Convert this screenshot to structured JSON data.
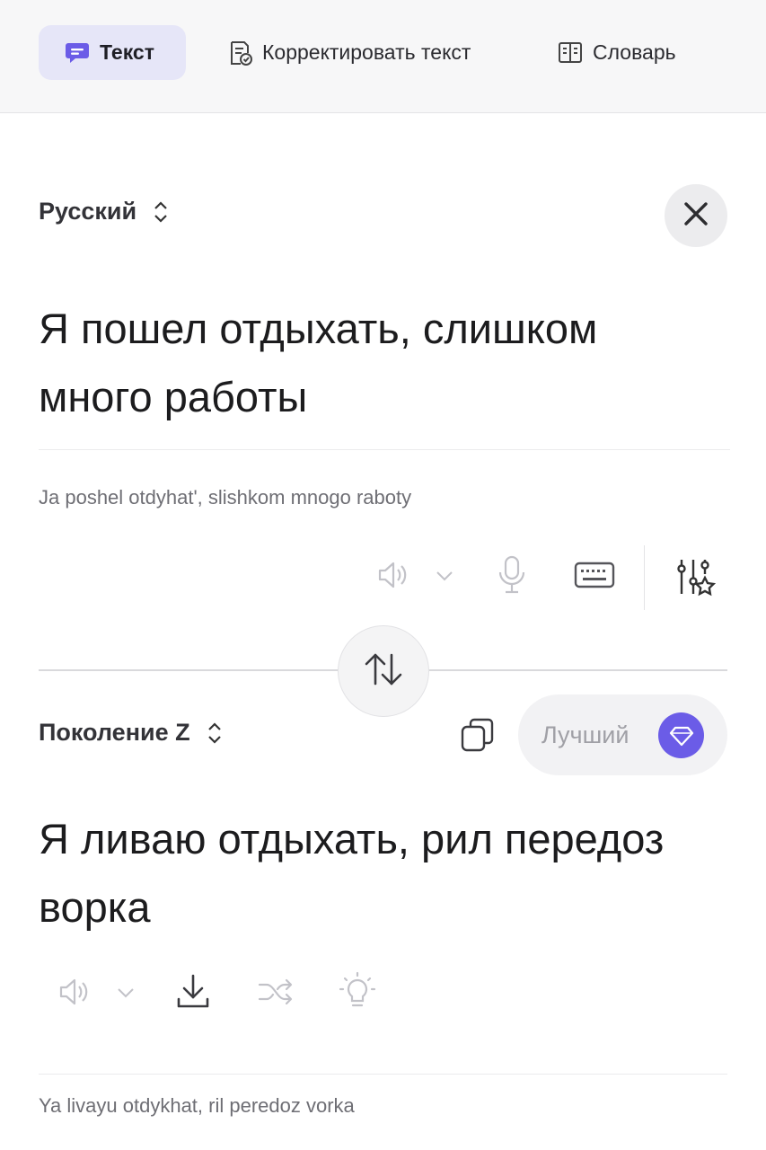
{
  "tabs": [
    {
      "label": "Текст",
      "icon": "chat-bubble-icon",
      "active": true
    },
    {
      "label": "Корректировать текст",
      "icon": "document-check-icon",
      "active": false
    },
    {
      "label": "Словарь",
      "icon": "book-icon",
      "active": false
    }
  ],
  "source": {
    "language": "Русский",
    "text_line1": "Я пошел отдыхать, слишком",
    "text_line2": "много работы",
    "transliteration": "Ja poshel otdyhat', slishkom mnogo raboty"
  },
  "target": {
    "language": "Поколение Z",
    "best_label": "Лучший",
    "text_line1": "Я ливаю отдыхать, рил передоз",
    "text_line2": "ворка",
    "transliteration": "Ya livayu otdykhat, ril peredoz vorka"
  },
  "colors": {
    "accent": "#6b5ce7",
    "active_tab_bg": "#e6e6f8",
    "tabs_bg": "#f7f7f8"
  }
}
